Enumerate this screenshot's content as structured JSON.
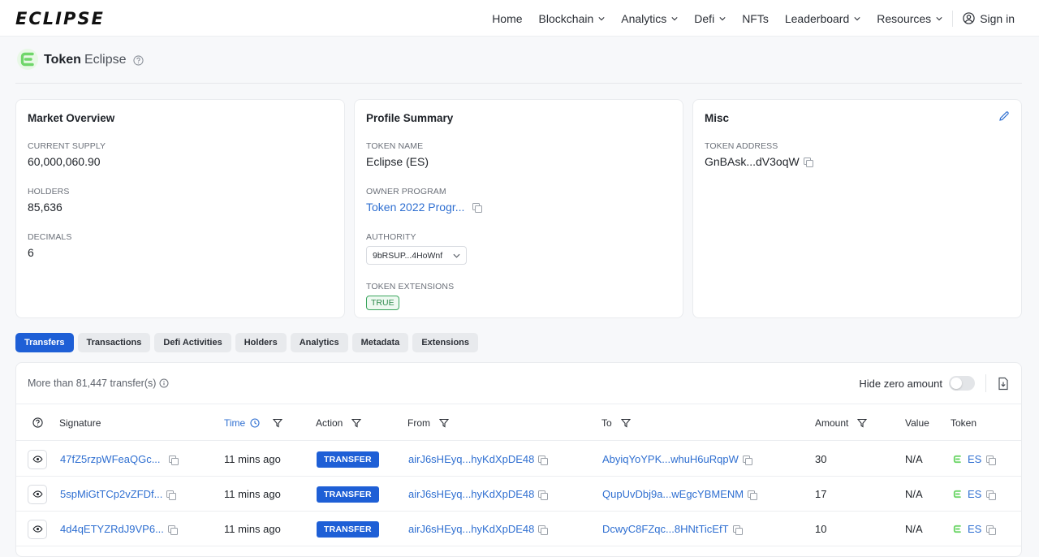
{
  "brand": {
    "logo_text": "ECLIPSE"
  },
  "nav": {
    "items": [
      {
        "label": "Home",
        "dropdown": false
      },
      {
        "label": "Blockchain",
        "dropdown": true
      },
      {
        "label": "Analytics",
        "dropdown": true
      },
      {
        "label": "Defi",
        "dropdown": true
      },
      {
        "label": "NFTs",
        "dropdown": false
      },
      {
        "label": "Leaderboard",
        "dropdown": true
      },
      {
        "label": "Resources",
        "dropdown": true
      }
    ],
    "signin": "Sign in"
  },
  "header": {
    "title": "Token",
    "subtitle": "Eclipse"
  },
  "market": {
    "title": "Market Overview",
    "fields": [
      {
        "label": "CURRENT SUPPLY",
        "value": "60,000,060.90"
      },
      {
        "label": "HOLDERS",
        "value": "85,636"
      },
      {
        "label": "DECIMALS",
        "value": "6"
      }
    ]
  },
  "profile": {
    "title": "Profile Summary",
    "token_name_label": "TOKEN NAME",
    "token_name": "Eclipse (ES)",
    "owner_label": "OWNER PROGRAM",
    "owner": "Token 2022 Progr...",
    "authority_label": "AUTHORITY",
    "authority": "9bRSUP...4HoWnf",
    "extensions_label": "TOKEN EXTENSIONS",
    "extensions": "TRUE"
  },
  "misc": {
    "title": "Misc",
    "address_label": "TOKEN ADDRESS",
    "address": "GnBAsk...dV3oqW"
  },
  "tabs": [
    "Transfers",
    "Transactions",
    "Defi Activities",
    "Holders",
    "Analytics",
    "Metadata",
    "Extensions"
  ],
  "table": {
    "count_text": "More than 81,447 transfer(s)",
    "hide_zero": "Hide zero amount",
    "columns": {
      "signature": "Signature",
      "time": "Time",
      "action": "Action",
      "from": "From",
      "to": "To",
      "amount": "Amount",
      "value": "Value",
      "token": "Token"
    },
    "rows": [
      {
        "signature": "47fZ5rzpWFeaQGc...",
        "time": "11 mins ago",
        "action": "TRANSFER",
        "from": "airJ6sHEyq...hyKdXpDE48",
        "to": "AbyiqYoYPK...whuH6uRqpW",
        "amount": "30",
        "value": "N/A",
        "token": "ES"
      },
      {
        "signature": "5spMiGtTCp2vZFDf...",
        "time": "11 mins ago",
        "action": "TRANSFER",
        "from": "airJ6sHEyq...hyKdXpDE48",
        "to": "QupUvDbj9a...wEgcYBMENM",
        "amount": "17",
        "value": "N/A",
        "token": "ES"
      },
      {
        "signature": "4d4qETYZRdJ9VP6...",
        "time": "11 mins ago",
        "action": "TRANSFER",
        "from": "airJ6sHEyq...hyKdXpDE48",
        "to": "DcwyC8FZqc...8HNtTicEfT",
        "amount": "10",
        "value": "N/A",
        "token": "ES"
      }
    ]
  },
  "colors": {
    "accent": "#1e5fd6",
    "link": "#2f6fd1",
    "brand_green": "#6fd66a"
  }
}
